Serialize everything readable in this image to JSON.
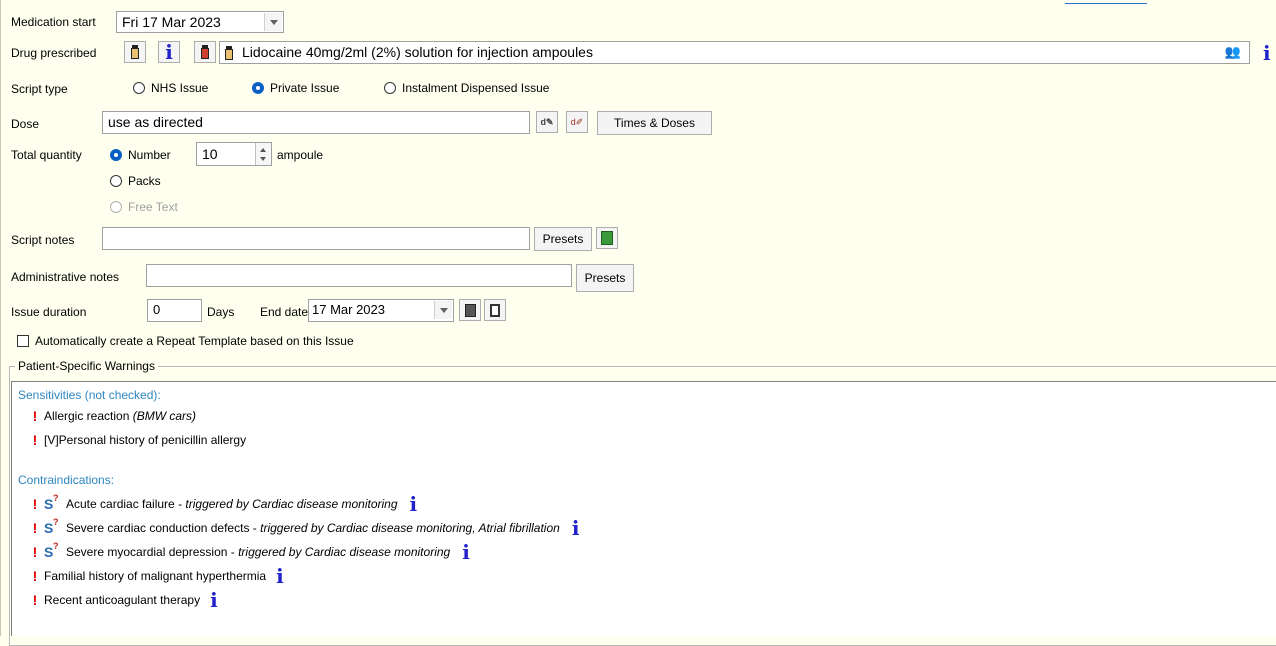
{
  "medication_start": {
    "label": "Medication start",
    "value": "Fri 17 Mar 2023"
  },
  "drug_prescribed": {
    "label": "Drug prescribed",
    "value": "Lidocaine 40mg/2ml (2%) solution for injection ampoules"
  },
  "script_type": {
    "label": "Script type",
    "options": [
      "NHS Issue",
      "Private Issue",
      "Instalment Dispensed Issue"
    ],
    "selected": "Private Issue"
  },
  "dose": {
    "label": "Dose",
    "value": "use as directed",
    "times_button": "Times & Doses"
  },
  "total_quantity": {
    "label": "Total quantity",
    "number_label": "Number",
    "number_value": "10",
    "unit": "ampoule",
    "packs_label": "Packs",
    "free_text_label": "Free Text",
    "selected": "Number"
  },
  "script_notes": {
    "label": "Script notes",
    "value": "",
    "presets_button": "Presets"
  },
  "admin_notes": {
    "label": "Administrative notes",
    "value": "",
    "presets_button": "Presets"
  },
  "issue_duration": {
    "label": "Issue duration",
    "value": "0",
    "unit": "Days",
    "end_date_label": "End date",
    "end_date_value": "17 Mar 2023"
  },
  "auto_repeat": {
    "label": "Automatically create a Repeat Template based on this Issue",
    "checked": false
  },
  "warnings": {
    "title": "Patient-Specific Warnings",
    "sensitivities": {
      "title": "Sensitivities (not checked):",
      "items": [
        {
          "text": "Allergic reaction",
          "detail": "(BMW cars)"
        },
        {
          "text": "[V]Personal history of penicillin allergy",
          "detail": ""
        }
      ]
    },
    "contraindications": {
      "title": "Contraindications:",
      "items": [
        {
          "text": "Acute cardiac failure",
          "sep": " - ",
          "detail": "triggered by Cardiac disease monitoring",
          "has_s": true
        },
        {
          "text": "Severe cardiac conduction defects",
          "sep": " - ",
          "detail": "triggered by Cardiac disease monitoring, Atrial fibrillation",
          "has_s": true
        },
        {
          "text": "Severe myocardial depression",
          "sep": " - ",
          "detail": "triggered by Cardiac disease monitoring",
          "has_s": true
        },
        {
          "text": "Familial history of malignant hyperthermia",
          "sep": "",
          "detail": "",
          "has_s": false
        },
        {
          "text": "Recent anticoagulant therapy",
          "sep": "",
          "detail": "",
          "has_s": false
        }
      ]
    }
  },
  "colors": {
    "section_title": "#2e86c1",
    "warning": "#e00000",
    "info": "#2222cc",
    "radio_selected": "#0a5fc4"
  }
}
